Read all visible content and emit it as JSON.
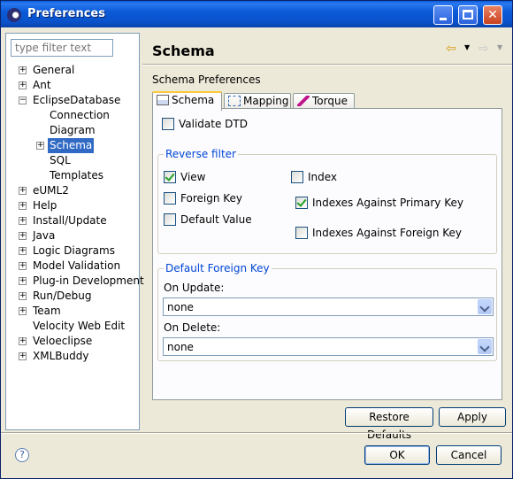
{
  "window": {
    "title": "Preferences"
  },
  "filter": {
    "placeholder": "type filter text"
  },
  "tree": [
    {
      "label": "General",
      "expander": "+",
      "indent": 0
    },
    {
      "label": "Ant",
      "expander": "+",
      "indent": 0
    },
    {
      "label": "EclipseDatabase",
      "expander": "−",
      "indent": 0
    },
    {
      "label": "Connection",
      "expander": "",
      "indent": 1
    },
    {
      "label": "Diagram",
      "expander": "",
      "indent": 1
    },
    {
      "label": "Schema",
      "expander": "+",
      "indent": 1,
      "selected": true
    },
    {
      "label": "SQL",
      "expander": "",
      "indent": 1
    },
    {
      "label": "Templates",
      "expander": "",
      "indent": 1
    },
    {
      "label": "eUML2",
      "expander": "+",
      "indent": 0
    },
    {
      "label": "Help",
      "expander": "+",
      "indent": 0
    },
    {
      "label": "Install/Update",
      "expander": "+",
      "indent": 0
    },
    {
      "label": "Java",
      "expander": "+",
      "indent": 0
    },
    {
      "label": "Logic Diagrams",
      "expander": "+",
      "indent": 0
    },
    {
      "label": "Model Validation",
      "expander": "+",
      "indent": 0
    },
    {
      "label": "Plug-in Development",
      "expander": "+",
      "indent": 0
    },
    {
      "label": "Run/Debug",
      "expander": "+",
      "indent": 0
    },
    {
      "label": "Team",
      "expander": "+",
      "indent": 0
    },
    {
      "label": "Velocity Web Edit",
      "expander": "",
      "indent": 0
    },
    {
      "label": "Veloeclipse",
      "expander": "+",
      "indent": 0
    },
    {
      "label": "XMLBuddy",
      "expander": "+",
      "indent": 0
    }
  ],
  "page": {
    "title": "Schema",
    "section_label": "Schema Preferences",
    "tabs": [
      "Schema",
      "Mapping",
      "Torque"
    ],
    "validate_dtd": {
      "label": "Validate DTD",
      "checked": false
    },
    "reverse_filter": {
      "legend": "Reverse filter",
      "view": {
        "label": "View",
        "checked": true
      },
      "index": {
        "label": "Index",
        "checked": false
      },
      "foreign_key": {
        "label": "Foreign Key",
        "checked": false
      },
      "indexes_pk": {
        "label": "Indexes Against Primary Key",
        "checked": true
      },
      "default_value": {
        "label": "Default Value",
        "checked": false
      },
      "indexes_fk": {
        "label": "Indexes Against Foreign Key",
        "checked": false
      }
    },
    "default_fk": {
      "legend": "Default Foreign Key",
      "on_update_label": "On Update:",
      "on_update_value": "none",
      "on_delete_label": "On Delete:",
      "on_delete_value": "none"
    },
    "restore_defaults": "Restore Defaults",
    "apply": "Apply"
  },
  "footer": {
    "ok": "OK",
    "cancel": "Cancel",
    "help_glyph": "?"
  }
}
